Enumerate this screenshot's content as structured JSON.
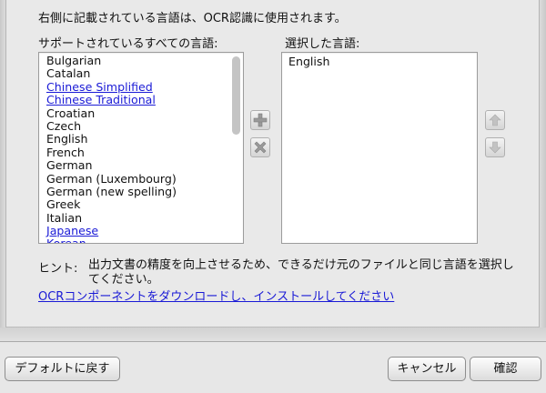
{
  "header": {
    "text": "右側に記載されている言語は、OCR認識に使用されます。"
  },
  "available": {
    "label": "サポートされているすべての言語:",
    "items": [
      {
        "label": "Bulgarian",
        "link": false
      },
      {
        "label": "Catalan",
        "link": false
      },
      {
        "label": "Chinese Simplified",
        "link": true
      },
      {
        "label": "Chinese Traditional",
        "link": true
      },
      {
        "label": "Croatian",
        "link": false
      },
      {
        "label": "Czech",
        "link": false
      },
      {
        "label": "English",
        "link": false
      },
      {
        "label": "French",
        "link": false
      },
      {
        "label": "German",
        "link": false
      },
      {
        "label": "German (Luxembourg)",
        "link": false
      },
      {
        "label": "German (new spelling)",
        "link": false
      },
      {
        "label": "Greek",
        "link": false
      },
      {
        "label": "Italian",
        "link": false
      },
      {
        "label": "Japanese",
        "link": true
      },
      {
        "label": "Korean",
        "link": true
      }
    ]
  },
  "selected": {
    "label": "選択した言語:",
    "items": [
      "English"
    ]
  },
  "icons": {
    "add": "plus-icon",
    "remove": "x-icon",
    "up": "arrow-up-icon",
    "down": "arrow-down-icon"
  },
  "hint": {
    "label": "ヒント:",
    "text": "出力文書の精度を向上させるため、できるだけ元のファイルと同じ言語を選択してください。"
  },
  "download_link": "OCRコンポーネントをダウンロードし、インストールしてください",
  "footer": {
    "default_label": "デフォルトに戻す",
    "cancel_label": "キャンセル",
    "ok_label": "確認"
  },
  "colors": {
    "link": "#1a1ad6",
    "icon_gray": "#9a9a9a",
    "background": "#e9e9e9"
  }
}
